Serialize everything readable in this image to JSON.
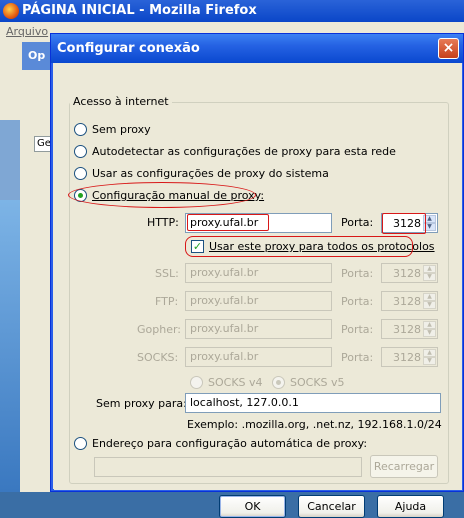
{
  "background": {
    "window_title": "PÁGINA INICIAL - Mozilla Firefox",
    "menu_first": "Arquivo",
    "options_title_fragment": "Op",
    "tab_fragment": "Ge"
  },
  "dialog": {
    "title": "Configurar conexão",
    "close_label": "×",
    "group_label": "Acesso à internet",
    "radio_no_proxy": "Sem proxy",
    "radio_autodetect": "Autodetectar as configurações de proxy para esta rede",
    "radio_system": "Usar as configurações de proxy do sistema",
    "radio_manual": "Configuração manual de proxy:",
    "http_label": "HTTP:",
    "http_value": "proxy.ufal.br",
    "port_label": "Porta:",
    "http_port": "3128",
    "use_for_all_label": "Usar este proxy para todos os protocolos",
    "ssl_label": "SSL:",
    "ssl_value": "proxy.ufal.br",
    "ssl_port": "3128",
    "ftp_label": "FTP:",
    "ftp_value": "proxy.ufal.br",
    "ftp_port": "3128",
    "gopher_label": "Gopher:",
    "gopher_value": "proxy.ufal.br",
    "gopher_port": "3128",
    "socks_label": "SOCKS:",
    "socks_value": "proxy.ufal.br",
    "socks_port": "3128",
    "socks_v4": "SOCKS v4",
    "socks_v5": "SOCKS v5",
    "no_proxy_label": "Sem proxy para:",
    "no_proxy_value": "localhost, 127.0.0.1",
    "example": "Exemplo: .mozilla.org, .net.nz, 192.168.1.0/24",
    "radio_auto_config": "Endereço para configuração automática de proxy:",
    "auto_config_value": "",
    "reload_button": "Recarregar",
    "ok_button": "OK",
    "cancel_button": "Cancelar",
    "help_button": "Ajuda"
  },
  "colors": {
    "annotation": "#d81818",
    "titlebar": "#0a48cf"
  }
}
